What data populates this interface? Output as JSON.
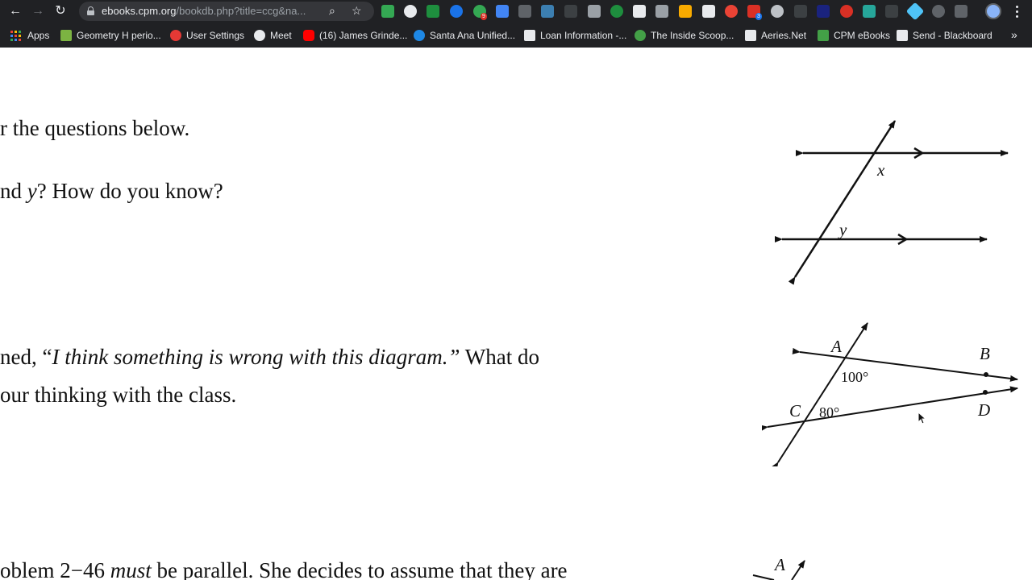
{
  "browser": {
    "url_host": "ebooks.cpm.org",
    "url_path": "/bookdb.php?title=ccg&na...",
    "extension_badges": [
      "9",
      "3"
    ],
    "bookmarks": [
      {
        "label": "Apps",
        "icon": "apps-grid-icon"
      },
      {
        "label": "Geometry H perio...",
        "icon": "classroom-icon",
        "color": "#7cb342"
      },
      {
        "label": "User Settings",
        "icon": "settings-icon",
        "color": "#e53935"
      },
      {
        "label": "Meet",
        "icon": "globe-icon",
        "color": "#e8eaed"
      },
      {
        "label": "(16) James Grinde...",
        "icon": "youtube-icon",
        "color": "#ff0000"
      },
      {
        "label": "Santa Ana Unified...",
        "icon": "district-icon",
        "color": "#1e88e5"
      },
      {
        "label": "Loan Information -...",
        "icon": "document-icon",
        "color": "#e8eaed"
      },
      {
        "label": "The Inside Scoop...",
        "icon": "sparkle-icon",
        "color": "#43a047"
      },
      {
        "label": "Aeries.Net",
        "icon": "aeries-icon",
        "color": "#e8eaed"
      },
      {
        "label": "CPM eBooks",
        "icon": "cpm-icon",
        "color": "#43a047"
      },
      {
        "label": "Send - Blackboard",
        "icon": "blackboard-icon",
        "color": "#e8eaed"
      }
    ]
  },
  "content": {
    "line1": "r the questions below.",
    "line2_a": "nd ",
    "line2_var": "y",
    "line2_b": "?  How do you know?",
    "line3_a": "ned, “",
    "line3_quote": "I think something is wrong with this diagram.”",
    "line3_b": "  What do",
    "line4": "our thinking with the class.",
    "line5_a": "oblem 2−46 ",
    "line5_em": "must",
    "line5_b": " be parallel.  She decides to assume that they are"
  },
  "diagram1": {
    "angle_labels": [
      "x",
      "y"
    ]
  },
  "diagram2": {
    "point_labels": [
      "A",
      "B",
      "C",
      "D"
    ],
    "angle_values": [
      "100°",
      "80°"
    ]
  },
  "diagram3": {
    "point_label": "A"
  }
}
